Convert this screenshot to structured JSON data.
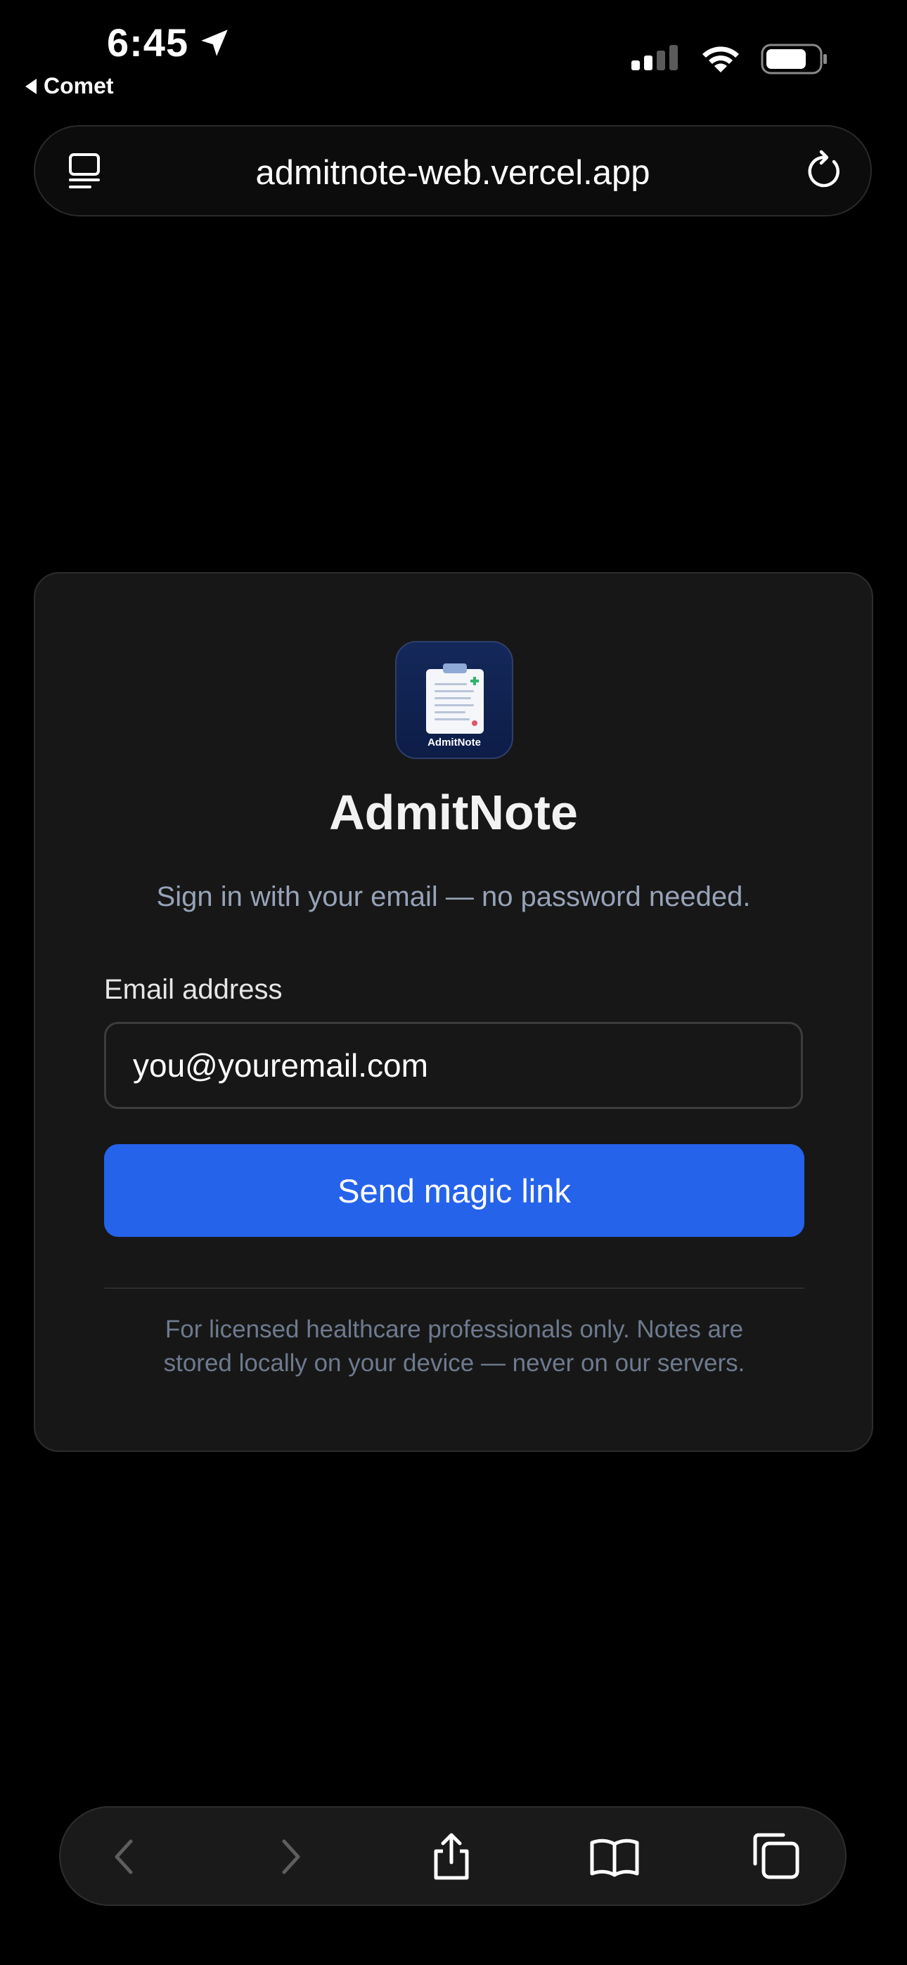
{
  "status_bar": {
    "time": "6:45",
    "back_app_label": "Comet",
    "icons": [
      "location-arrow-icon",
      "signal-icon",
      "wifi-icon",
      "battery-icon"
    ]
  },
  "address_bar": {
    "url": "admitnote-web.vercel.app",
    "icons": [
      "tab-overview-icon",
      "reload-icon"
    ]
  },
  "card": {
    "logo_text": "AdmitNote",
    "title": "AdmitNote",
    "subtitle": "Sign in with your email — no password needed.",
    "email_label": "Email address",
    "email_placeholder": "you@youremail.com",
    "submit_label": "Send magic link",
    "footer_line_1": "For licensed healthcare professionals only. Notes are",
    "footer_line_2": "stored locally on your device — never on our servers."
  },
  "toolbar": {
    "icons": [
      "back-icon",
      "forward-icon",
      "share-icon",
      "bookmarks-icon",
      "tabs-icon"
    ]
  },
  "colors": {
    "background": "#000000",
    "card": "#171717",
    "accent": "#2563eb",
    "subtitle": "#97a3b8",
    "footer": "#6e7a8e"
  }
}
